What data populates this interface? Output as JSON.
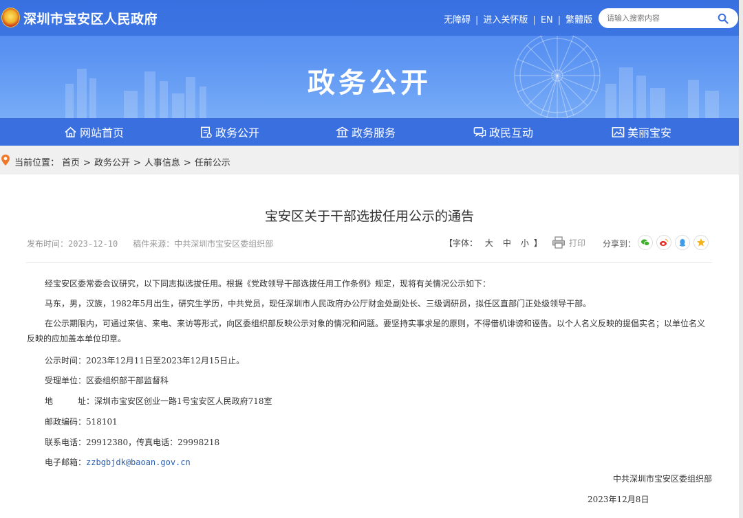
{
  "header": {
    "site_name": "深圳市宝安区人民政府",
    "links": [
      "无障碍",
      "进入关怀版",
      "EN",
      "繁體版"
    ],
    "separator": "|",
    "search_placeholder": "请输入搜索内容",
    "banner_title": "政务公开"
  },
  "nav": {
    "items": [
      {
        "label": "网站首页",
        "icon": "home-icon"
      },
      {
        "label": "政务公开",
        "icon": "document-icon"
      },
      {
        "label": "政务服务",
        "icon": "government-building-icon"
      },
      {
        "label": "政民互动",
        "icon": "chat-icon"
      },
      {
        "label": "美丽宝安",
        "icon": "picture-icon"
      }
    ]
  },
  "breadcrumb": {
    "prefix": "当前位置：",
    "items": [
      "首页",
      "政务公开",
      "人事信息",
      "任前公示"
    ],
    "separator": ">"
  },
  "article": {
    "title": "宝安区关于干部选拔任用公示的通告",
    "publish_time": "发布时间：2023-12-10",
    "source": "稿件来源：中共深圳市宝安区委组织部",
    "font_label": "【字体：",
    "font_sizes": [
      "大",
      "中",
      "小"
    ],
    "font_close": "】",
    "print_label": "打印",
    "share_label": "分享到：",
    "share_icons": [
      "wechat-icon",
      "weibo-icon",
      "qq-icon",
      "qzone-icon"
    ],
    "paragraphs": {
      "p1": "经宝安区委常委会议研究，以下同志拟选拔任用。根据《党政领导干部选拔任用工作条例》规定，现将有关情况公示如下：",
      "p2": "马东，男，汉族，1982年5月出生，研究生学历，中共党员，现任深圳市人民政府办公厅财金处副处长、三级调研员，拟任区直部门正处级领导干部。",
      "p3": "在公示期限内，可通过来信、来电、来访等形式，向区委组织部反映公示对象的情况和问题。要坚持实事求是的原则，不得借机诽谤和诬告。以个人名义反映的提倡实名；以单位名义反映的应加盖本单位印章。",
      "p4": "公示时间：2023年12月11日至2023年12月15日止。",
      "p5": "受理单位：区委组织部干部监督科",
      "p6_label": "地　　　址：",
      "p6_value": "深圳市宝安区创业一路1号宝安区人民政府718室",
      "p7": "邮政编码：518101",
      "p8": "联系电话：29912380，传真电话：29998218",
      "p9_label": "电子邮箱：",
      "p9_email": "zzbgbjdk@baoan.gov.cn"
    },
    "signature_org": "中共深圳市宝安区委组织部",
    "signature_date": "2023年12月8日"
  },
  "colors": {
    "banner_blue": "#5a93f2",
    "nav_blue": "#3a6fe0",
    "breadcrumb_bg": "#f0f0f0",
    "link_blue": "#2a5db0"
  }
}
